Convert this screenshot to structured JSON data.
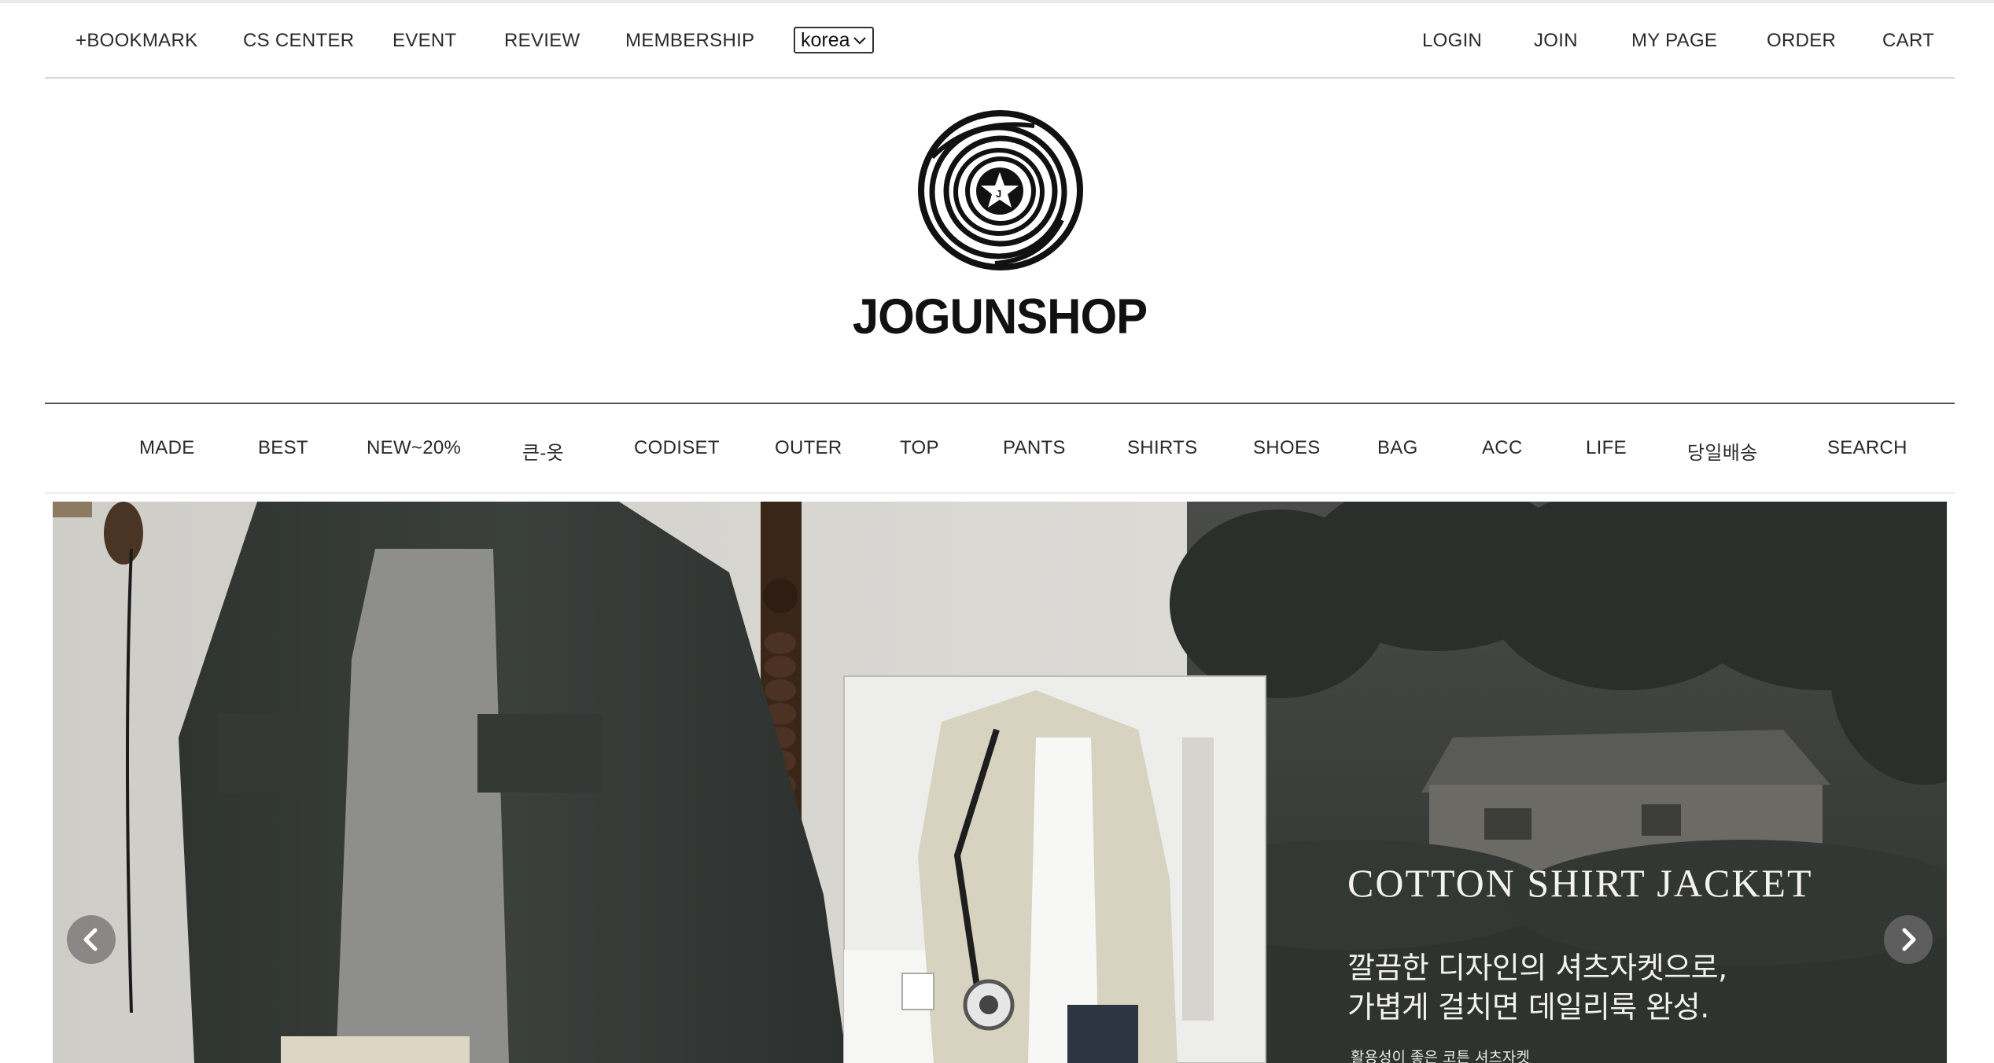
{
  "utility_nav": {
    "left": [
      "+BOOKMARK",
      "CS CENTER",
      "EVENT",
      "REVIEW",
      "MEMBERSHIP"
    ],
    "language": "korea",
    "right": [
      "LOGIN",
      "JOIN",
      "MY PAGE",
      "ORDER",
      "CART"
    ]
  },
  "logo": {
    "text": "JOGUNSHOP"
  },
  "main_nav": [
    "MADE",
    "BEST",
    "NEW~20%",
    "큰-옷",
    "CODISET",
    "OUTER",
    "TOP",
    "PANTS",
    "SHIRTS",
    "SHOES",
    "BAG",
    "ACC",
    "LIFE",
    "당일배송",
    "SEARCH"
  ],
  "hero": {
    "title": "COTTON SHIRT JACKET",
    "subtitle_line1": "깔끔한 디자인의 셔츠자켓으로,",
    "subtitle_line2": "가볍게 걸치면 데일리룩 완성.",
    "small_text": "활용성이 좋은 코튼 셔츠자켓"
  },
  "icons": {
    "prev": "chevron-left-icon",
    "next": "chevron-right-icon",
    "dropdown": "chevron-down-icon"
  }
}
